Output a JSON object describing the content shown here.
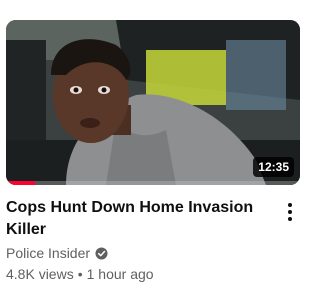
{
  "video": {
    "duration": "12:35",
    "watched_fraction": 0.1,
    "title": "Cops Hunt Down Home Invasion Killer",
    "channel": "Police Insider",
    "verified_icon": "verified-check-icon",
    "views": "4.8K views",
    "separator": "•",
    "age": "1 hour ago",
    "menu_icon": "more-vert-icon"
  },
  "colors": {
    "progress": "#ff0033",
    "title": "#0f0f0f",
    "secondary": "#606060"
  }
}
